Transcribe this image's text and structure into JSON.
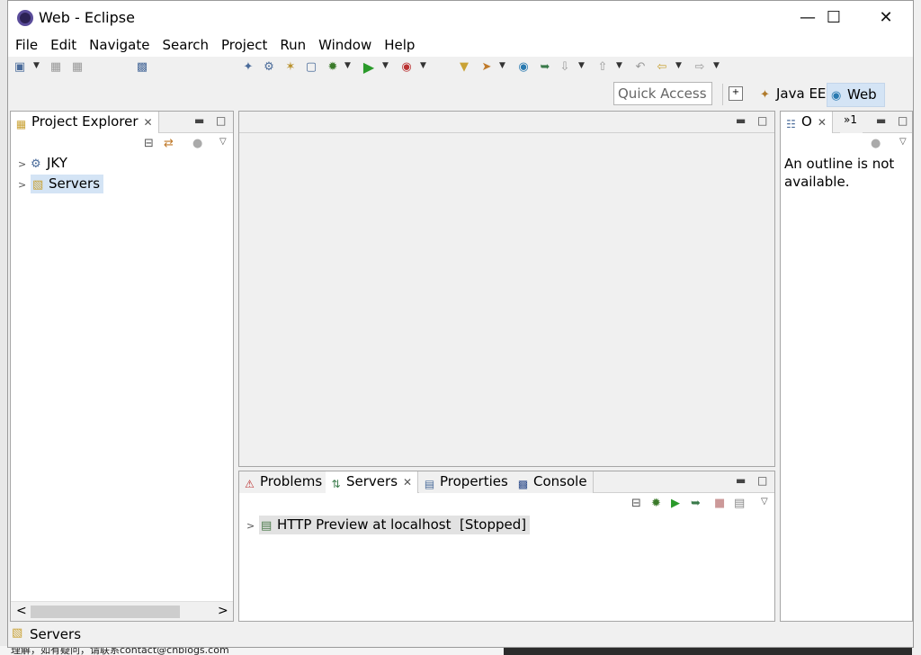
{
  "window": {
    "title": "Web - Eclipse",
    "minimize": "—",
    "maximize": "☐",
    "close": "✕"
  },
  "menu": [
    "File",
    "Edit",
    "Navigate",
    "Search",
    "Project",
    "Run",
    "Window",
    "Help"
  ],
  "toolbar": {
    "quick_access_placeholder": "Quick Access",
    "perspectives": [
      {
        "label": "Java EE"
      },
      {
        "label": "Web",
        "active": true
      }
    ]
  },
  "project_explorer": {
    "tab_label": "Project Explorer",
    "items": [
      {
        "label": "JKY"
      },
      {
        "label": "Servers",
        "selected": true
      }
    ]
  },
  "outline": {
    "tab_label": "O",
    "second_tab_label": "»1",
    "message": "An outline is not available."
  },
  "bottom_panel": {
    "tabs": [
      {
        "label": "Problems"
      },
      {
        "label": "Servers",
        "active": true
      },
      {
        "label": "Properties"
      },
      {
        "label": "Console"
      }
    ],
    "server_entry": "HTTP Preview at localhost  [Stopped]"
  },
  "status": {
    "text": "Servers"
  },
  "desktop_bottom_text": "理解，如有疑问，请联系contact@cnblogs.com"
}
